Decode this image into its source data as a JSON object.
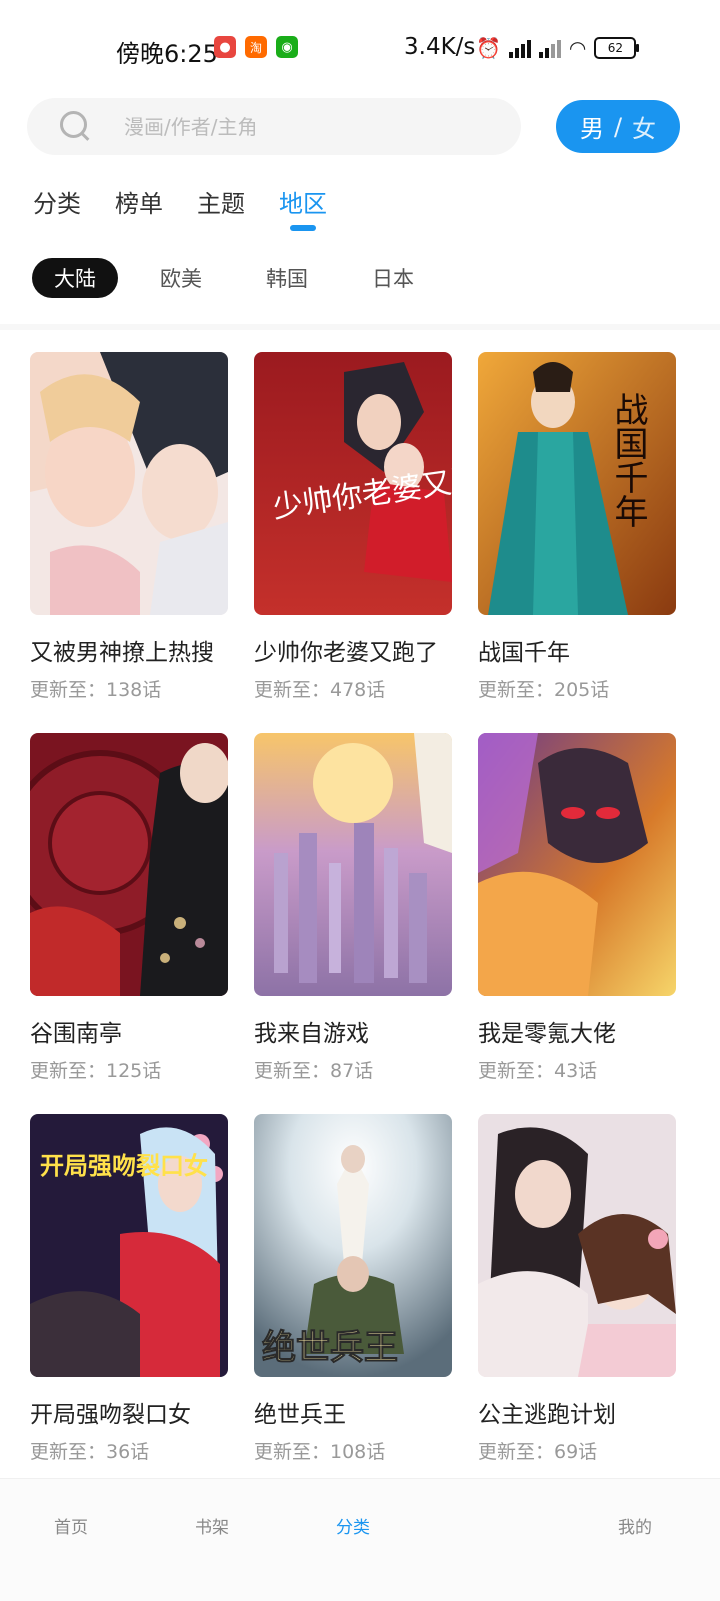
{
  "status_bar": {
    "time": "傍晚6:25",
    "network_speed": "3.4K/s",
    "battery": "62",
    "app_icons": [
      "red-bear-app-icon",
      "taobao-icon",
      "wechat-icon"
    ]
  },
  "search": {
    "placeholder": "漫画/作者/主角"
  },
  "gender_toggle": {
    "male": "男",
    "separator": "/",
    "female": "女"
  },
  "tabs": [
    {
      "label": "分类",
      "active": false
    },
    {
      "label": "榜单",
      "active": false
    },
    {
      "label": "主题",
      "active": false
    },
    {
      "label": "地区",
      "active": true
    }
  ],
  "regions": [
    {
      "label": "大陆",
      "active": true
    },
    {
      "label": "欧美",
      "active": false
    },
    {
      "label": "韩国",
      "active": false
    },
    {
      "label": "日本",
      "active": false
    }
  ],
  "comics": [
    {
      "title": "又被男神撩上热搜",
      "update": "更新至：138话"
    },
    {
      "title": "少帅你老婆又跑了",
      "update": "更新至：478话",
      "cover_text": "少帅你老婆又跑了"
    },
    {
      "title": "战国千年",
      "update": "更新至：205话",
      "cover_text": "战国千年"
    },
    {
      "title": "谷围南亭",
      "update": "更新至：125话"
    },
    {
      "title": "我来自游戏",
      "update": "更新至：87话"
    },
    {
      "title": "我是零氪大佬",
      "update": "更新至：43话"
    },
    {
      "title": "开局强吻裂口女",
      "update": "更新至：36话",
      "cover_text": "开局强吻裂口女"
    },
    {
      "title": "绝世兵王",
      "update": "更新至：108话",
      "cover_text": "绝世兵王"
    },
    {
      "title": "公主逃跑计划",
      "update": "更新至：69话"
    }
  ],
  "bottom_nav": [
    {
      "label": "首页",
      "active": false
    },
    {
      "label": "书架",
      "active": false
    },
    {
      "label": "分类",
      "active": true
    },
    {
      "label": "我的",
      "active": false
    }
  ],
  "colors": {
    "accent": "#1a95f0",
    "chip_active_bg": "#111111",
    "muted_text": "#999999"
  }
}
